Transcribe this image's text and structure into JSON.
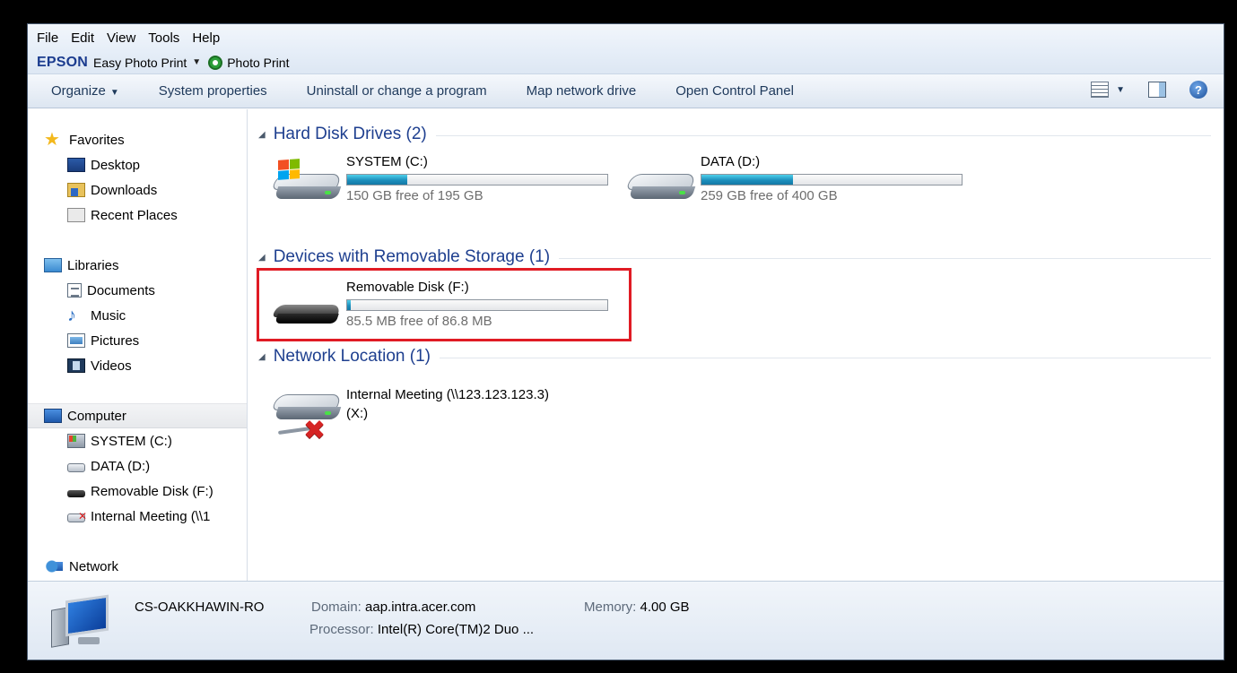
{
  "menu": [
    "File",
    "Edit",
    "View",
    "Tools",
    "Help"
  ],
  "epson": {
    "brand": "EPSON",
    "app": "Easy Photo Print",
    "photo_print": "Photo Print"
  },
  "commands": {
    "organize": "Organize",
    "system_properties": "System properties",
    "uninstall": "Uninstall or change a program",
    "map_drive": "Map network drive",
    "control_panel": "Open Control Panel"
  },
  "nav": {
    "favorites": {
      "label": "Favorites",
      "items": [
        "Desktop",
        "Downloads",
        "Recent Places"
      ]
    },
    "libraries": {
      "label": "Libraries",
      "items": [
        "Documents",
        "Music",
        "Pictures",
        "Videos"
      ]
    },
    "computer": {
      "label": "Computer",
      "items": [
        "SYSTEM (C:)",
        "DATA (D:)",
        "Removable Disk (F:)",
        "Internal Meeting (\\\\1"
      ]
    },
    "network": {
      "label": "Network"
    }
  },
  "groups": {
    "hdd": {
      "title": "Hard Disk Drives (2)",
      "drives": [
        {
          "name": "SYSTEM (C:)",
          "free": "150 GB free of 195 GB",
          "used_fraction": 0.23
        },
        {
          "name": "DATA (D:)",
          "free": "259 GB free of 400 GB",
          "used_fraction": 0.35
        }
      ]
    },
    "removable": {
      "title": "Devices with Removable Storage (1)",
      "drives": [
        {
          "name": "Removable Disk (F:)",
          "free": "85.5 MB free of 86.8 MB",
          "used_fraction": 0.015
        }
      ]
    },
    "network": {
      "title": "Network Location (1)",
      "drives": [
        {
          "name_line1": "Internal Meeting (\\\\123.123.123.3)",
          "name_line2": "(X:)"
        }
      ]
    }
  },
  "details": {
    "computer_name": "CS-OAKKHAWIN-RO",
    "domain_label": "Domain:",
    "domain_value": "aap.intra.acer.com",
    "memory_label": "Memory:",
    "memory_value": "4.00 GB",
    "processor_label": "Processor:",
    "processor_value": "Intel(R) Core(TM)2 Duo ..."
  },
  "colors": {
    "accent": "#1e3f8f",
    "highlight": "#e01b24",
    "bar": "#1d8fbd"
  },
  "icons": {
    "help": "help-icon",
    "views": "views-icon",
    "preview_pane": "preview-pane-icon",
    "help_glyph": "?"
  }
}
